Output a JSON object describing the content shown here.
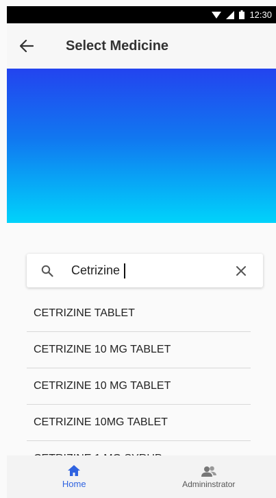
{
  "status_bar": {
    "time": "12:30",
    "icons": [
      "wifi-icon",
      "signal-icon",
      "battery-icon"
    ]
  },
  "app_bar": {
    "title": "Select Medicine",
    "back_icon": "back-arrow-icon"
  },
  "banner": {
    "gradient_top": "#2344ef",
    "gradient_bottom": "#00d3fb"
  },
  "search": {
    "value": "Cetrizine",
    "icon": "search-icon",
    "clear_icon": "close-icon"
  },
  "results": [
    "CETRIZINE TABLET",
    "CETRIZINE 10 MG TABLET",
    "CETRIZINE 10 MG TABLET",
    "CETRIZINE 10MG TABLET",
    "CETRIZINE 1 MG SYRUP"
  ],
  "bottom_nav": {
    "home_label": "Home",
    "admin_label": "Admininstrator",
    "active": "home",
    "active_color": "#2f63e0"
  }
}
